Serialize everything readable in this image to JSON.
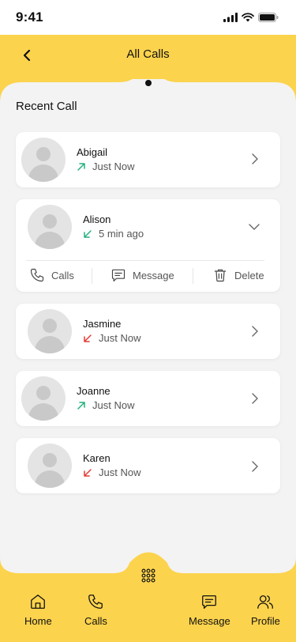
{
  "status_bar": {
    "time": "9:41"
  },
  "header": {
    "title": "All Calls"
  },
  "section": {
    "title": "Recent Call"
  },
  "calls": [
    {
      "name": "Abigail",
      "time": "Just Now",
      "direction": "outgoing"
    },
    {
      "name": "Alison",
      "time": "5 min ago",
      "direction": "incoming-answered"
    },
    {
      "name": "Jasmine",
      "time": "Just Now",
      "direction": "missed"
    },
    {
      "name": "Joanne",
      "time": "Just Now",
      "direction": "outgoing"
    },
    {
      "name": "Karen",
      "time": "Just Now",
      "direction": "missed"
    }
  ],
  "expanded_actions": {
    "calls": "Calls",
    "message": "Message",
    "delete": "Delete"
  },
  "nav": {
    "home": "Home",
    "calls": "Calls",
    "message": "Message",
    "profile": "Profile"
  },
  "colors": {
    "accent": "#FCD34D",
    "background": "#F3F3F3",
    "outgoing": "#22B07D",
    "missed": "#E53935"
  },
  "icons": {
    "back": "chevron-left-icon",
    "outgoing": "arrow-up-right-icon",
    "incoming": "arrow-down-left-icon",
    "chevron_right": "chevron-right-icon",
    "chevron_down": "chevron-down-icon",
    "dialpad": "dialpad-icon"
  }
}
